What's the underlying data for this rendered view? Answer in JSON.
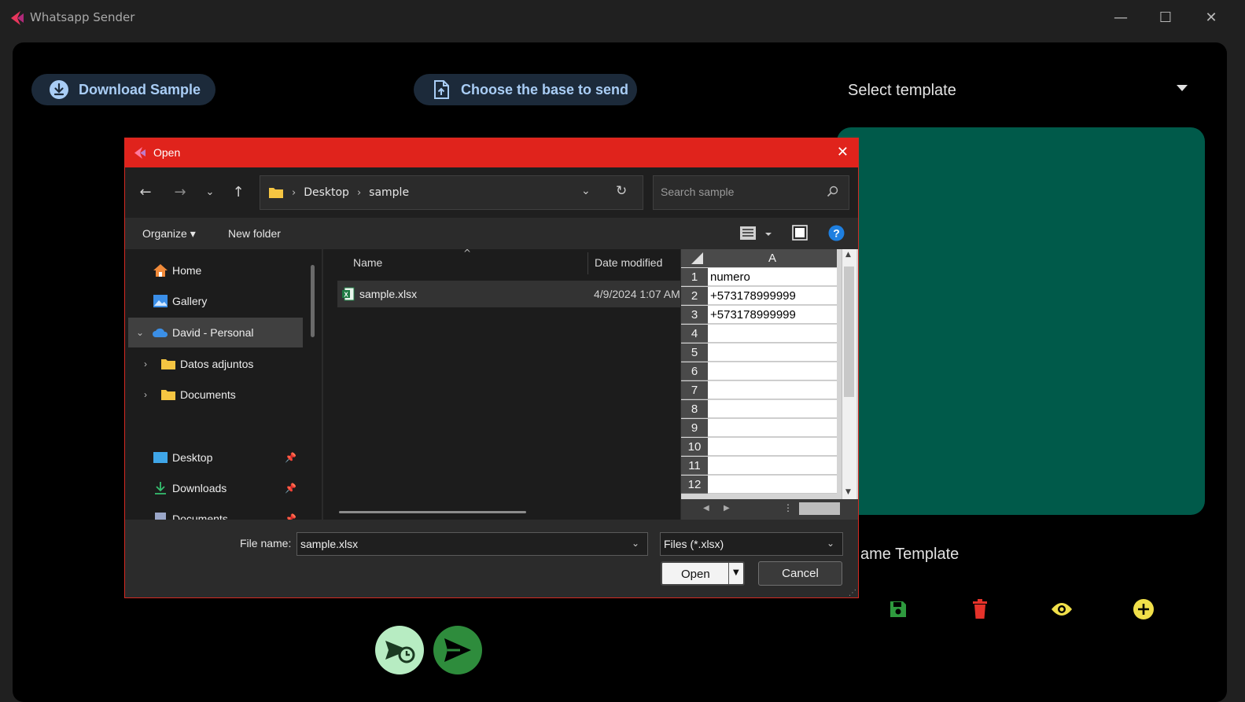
{
  "app": {
    "title": "Whatsapp Sender",
    "window_controls": {
      "minimize": "—",
      "maximize": "☐",
      "close": "✕"
    }
  },
  "toolbar": {
    "download_label": "Download Sample",
    "choose_label": "Choose the base to send",
    "template_select_label": "Select template"
  },
  "template": {
    "name_label": "ame Template",
    "preview_color": "#005a4a"
  },
  "actions": {
    "save_icon": "save-icon",
    "delete_icon": "delete-icon",
    "preview_icon": "eye-icon",
    "add_icon": "add-icon"
  },
  "dialog": {
    "title": "Open",
    "breadcrumb": [
      "Desktop",
      "sample"
    ],
    "search_placeholder": "Search sample",
    "organize_label": "Organize ▾",
    "new_folder_label": "New folder",
    "nav": {
      "home": "Home",
      "gallery": "Gallery",
      "personal": "David - Personal",
      "datos": "Datos adjuntos",
      "documents": "Documents",
      "desktop": "Desktop",
      "downloads": "Downloads",
      "documents2": "Documents"
    },
    "columns": {
      "name": "Name",
      "date": "Date modified"
    },
    "file": {
      "name": "sample.xlsx",
      "date": "4/9/2024 1:07 AM"
    },
    "preview": {
      "column": "A",
      "rows": [
        {
          "n": "1",
          "v": "numero"
        },
        {
          "n": "2",
          "v": "+573178999999"
        },
        {
          "n": "3",
          "v": "+573178999999"
        },
        {
          "n": "4",
          "v": ""
        },
        {
          "n": "5",
          "v": ""
        },
        {
          "n": "6",
          "v": ""
        },
        {
          "n": "7",
          "v": ""
        },
        {
          "n": "8",
          "v": ""
        },
        {
          "n": "9",
          "v": ""
        },
        {
          "n": "10",
          "v": ""
        },
        {
          "n": "11",
          "v": ""
        },
        {
          "n": "12",
          "v": ""
        }
      ]
    },
    "filename_label": "File name:",
    "filename_value": "sample.xlsx",
    "filetype": "Files (*.xlsx)",
    "open_label": "Open",
    "cancel_label": "Cancel"
  },
  "colors": {
    "accent_red": "#e0231c",
    "pill_bg": "#1c2a3a",
    "pill_text": "#a9cdf5",
    "save_green": "#2e9a3e",
    "delete_red": "#e5322a",
    "eye_yellow": "#f1e04a"
  }
}
